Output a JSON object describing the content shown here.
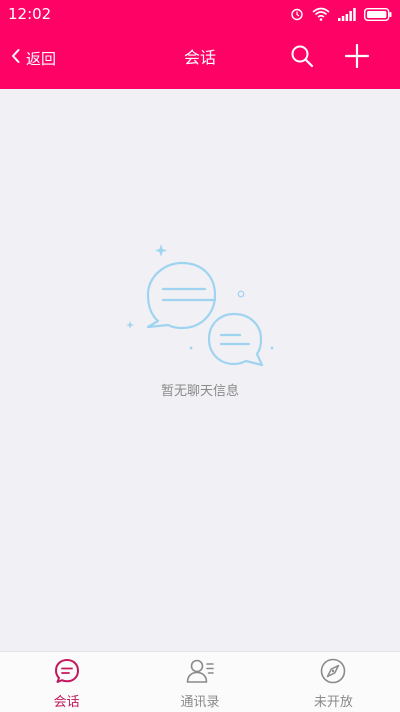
{
  "status_bar": {
    "time": "12:02",
    "icons": [
      "alarm-icon",
      "wifi-icon",
      "signal-icon",
      "battery-icon"
    ]
  },
  "app_bar": {
    "back_label": "返回",
    "title": "会话",
    "actions": [
      "search-icon",
      "plus-icon"
    ]
  },
  "main": {
    "empty_message": "暂无聊天信息"
  },
  "tabs": [
    {
      "label": "会话",
      "icon": "chat-icon",
      "active": true
    },
    {
      "label": "通讯录",
      "icon": "contacts-icon",
      "active": false
    },
    {
      "label": "未开放",
      "icon": "compass-icon",
      "active": false
    }
  ],
  "colors": {
    "accent": "#ff0266",
    "active_tab": "#c2185b",
    "inactive_tab": "#8a8a8a",
    "background": "#f0f0f5",
    "illustration": "#9fd4f0"
  }
}
